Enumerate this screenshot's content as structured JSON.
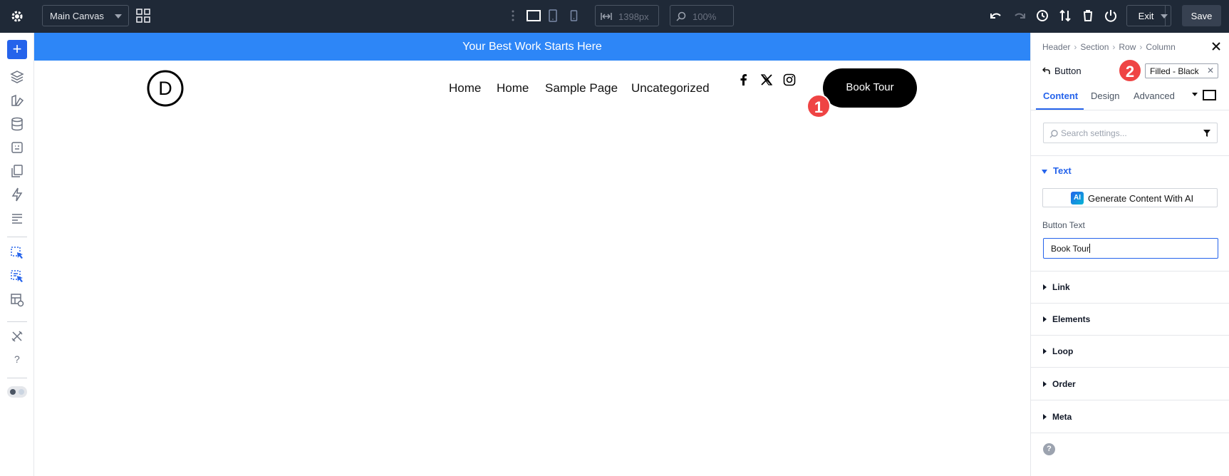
{
  "topbar": {
    "canvas_select": "Main Canvas",
    "width_value": "1398px",
    "zoom_value": "100%",
    "exit_label": "Exit",
    "save_label": "Save"
  },
  "banner": {
    "text": "Your Best Work Starts Here"
  },
  "header": {
    "logo_letter": "D",
    "nav": [
      "Home",
      "Home",
      "Sample Page",
      "Uncategorized"
    ],
    "button_label": "Book Tour"
  },
  "markers": {
    "one": "1",
    "two": "2"
  },
  "panel": {
    "breadcrumb": [
      "Header",
      "Section",
      "Row",
      "Column"
    ],
    "element_title": "Button",
    "preset": "Filled - Black",
    "tabs": [
      "Content",
      "Design",
      "Advanced"
    ],
    "search_placeholder": "Search settings...",
    "open_section": "Text",
    "ai_badge": "AI",
    "ai_button": "Generate Content With AI",
    "field_label": "Button Text",
    "field_value": "Book Tour",
    "sections": [
      "Link",
      "Elements",
      "Loop",
      "Order",
      "Meta"
    ],
    "help": "?"
  },
  "colors": {
    "topbar_bg": "#1f2937",
    "accent": "#2563eb",
    "banner": "#2d86f7",
    "marker": "#ef4444"
  }
}
